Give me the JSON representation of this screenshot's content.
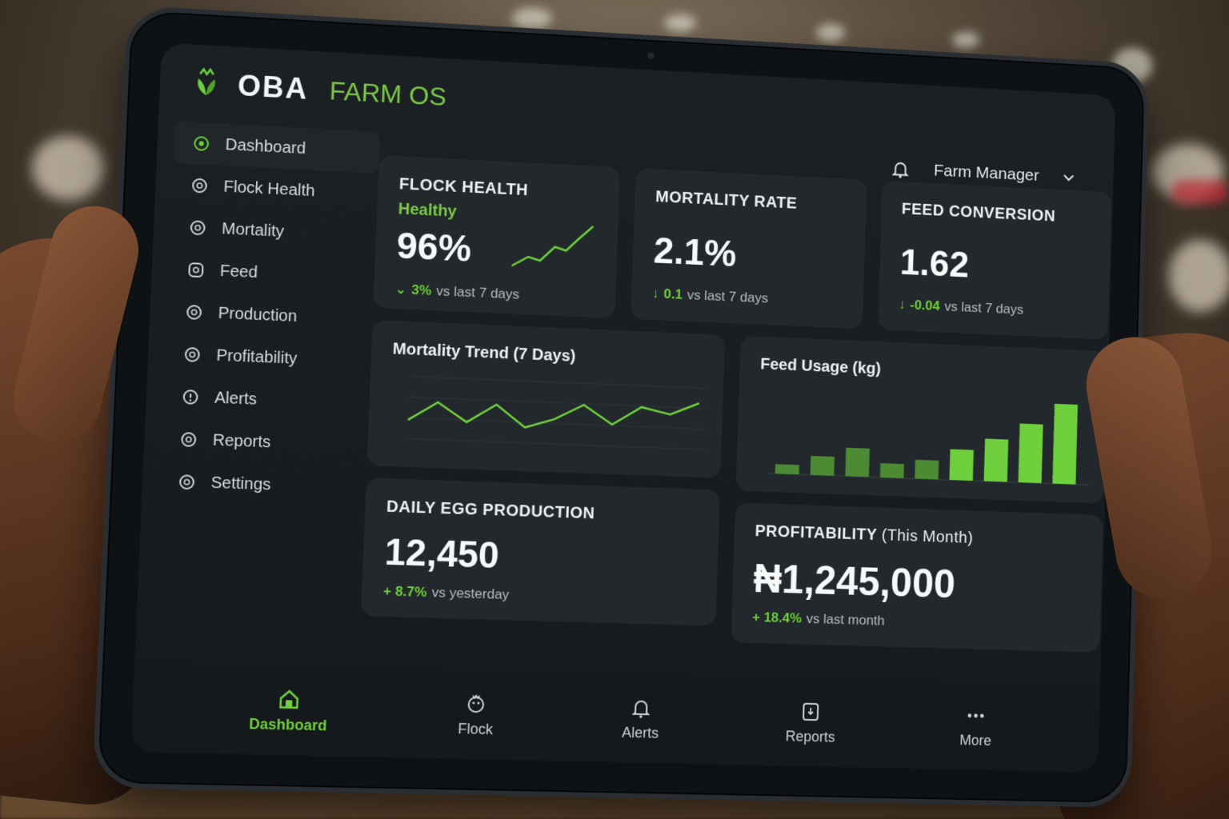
{
  "brand": {
    "name": "OBA",
    "sub": "FARM OS",
    "logo_icon": "leaf-crown-icon"
  },
  "topbar": {
    "user_label": "Farm Manager",
    "notification_icon": "bell-icon",
    "dropdown_icon": "chevron-down-icon"
  },
  "sidebar": {
    "items": [
      {
        "label": "Dashboard",
        "active": true
      },
      {
        "label": "Flock Health"
      },
      {
        "label": "Mortality"
      },
      {
        "label": "Feed"
      },
      {
        "label": "Production"
      },
      {
        "label": "Profitability"
      },
      {
        "label": "Alerts"
      },
      {
        "label": "Reports"
      },
      {
        "label": "Settings"
      }
    ]
  },
  "cards": {
    "flock": {
      "title": "FLOCK HEALTH",
      "status": "Healthy",
      "value": "96%",
      "delta": "3%",
      "delta_text": "vs last 7 days"
    },
    "mortality": {
      "title": "MORTALITY RATE",
      "value": "2.1%",
      "delta": "0.1",
      "delta_text": "vs last 7 days"
    },
    "feed": {
      "title": "FEED CONVERSION",
      "value": "1.62",
      "delta": "-0.04",
      "delta_text": "vs last 7 days"
    },
    "trend": {
      "title": "Mortality Trend (7 Days)"
    },
    "usage": {
      "title": "Feed Usage (kg)"
    },
    "egg": {
      "title": "DAILY EGG PRODUCTION",
      "value": "12,450",
      "delta": "+ 8.7%",
      "delta_text": "vs yesterday"
    },
    "profit": {
      "title": "PROFITABILITY",
      "title_sub": "(This Month)",
      "value": "₦1,245,000",
      "delta": "+ 18.4%",
      "delta_text": "vs last month"
    }
  },
  "chart_data": [
    {
      "type": "line",
      "title": "Mortality Trend (7 Days)",
      "values": [
        3,
        6,
        3,
        6,
        2.5,
        4,
        6.5,
        3.5,
        6.5,
        5.5,
        7.5
      ]
    },
    {
      "type": "bar",
      "title": "Feed Usage (kg)",
      "values": [
        2,
        4,
        6,
        3,
        4,
        6.5,
        9,
        12.5,
        17
      ]
    }
  ],
  "bottom_nav": [
    {
      "label": "Dashboard",
      "icon": "home-icon",
      "active": true
    },
    {
      "label": "Flock",
      "icon": "chicken-icon"
    },
    {
      "label": "Alerts",
      "icon": "bell-icon"
    },
    {
      "label": "Reports",
      "icon": "report-icon"
    },
    {
      "label": "More",
      "icon": "more-icon"
    }
  ],
  "colors": {
    "accent": "#6fcf3c",
    "screen_bg": "#1b2024",
    "card_bg": "#22282c"
  }
}
